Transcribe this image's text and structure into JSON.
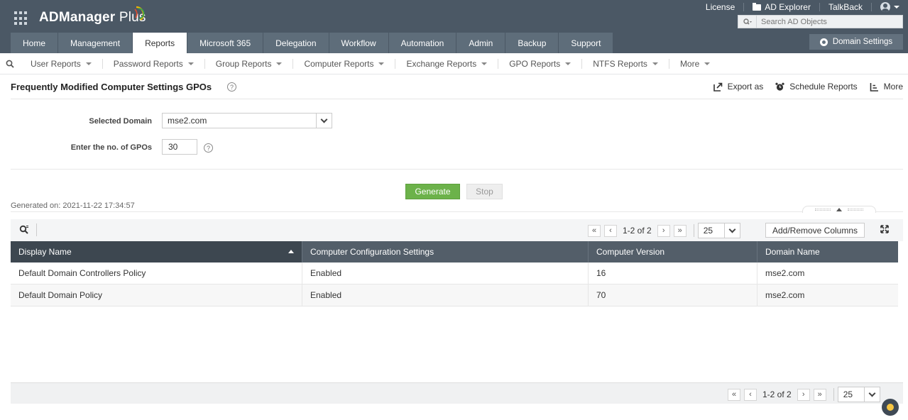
{
  "app": {
    "logo_text": "ADManager",
    "logo_plus": " Plus"
  },
  "top_links": {
    "license": "License",
    "ad_explorer": "AD Explorer",
    "talkback": "TalkBack"
  },
  "search": {
    "placeholder": "Search AD Objects"
  },
  "nav_tabs": [
    "Home",
    "Management",
    "Reports",
    "Microsoft 365",
    "Delegation",
    "Workflow",
    "Automation",
    "Admin",
    "Backup",
    "Support"
  ],
  "domain_settings_label": "Domain Settings",
  "sub_nav": [
    "User Reports",
    "Password Reports",
    "Group Reports",
    "Computer Reports",
    "Exchange Reports",
    "GPO Reports",
    "NTFS Reports",
    "More"
  ],
  "page": {
    "title": "Frequently Modified Computer Settings GPOs",
    "help_glyph": "?",
    "actions": {
      "export": "Export as",
      "schedule": "Schedule Reports",
      "more": "More"
    }
  },
  "form": {
    "domain_label": "Selected Domain",
    "domain_value": "mse2.com",
    "gpo_label": "Enter the no. of GPOs",
    "gpo_value": "30"
  },
  "buttons": {
    "generate": "Generate",
    "stop": "Stop"
  },
  "generated_on": "Generated on: 2021-11-22 17:34:57",
  "pager": {
    "text": "1-2 of 2",
    "page_size": "25",
    "first": "«",
    "prev": "‹",
    "next": "›",
    "last": "»"
  },
  "add_remove_columns": "Add/Remove Columns",
  "table": {
    "headers": [
      "Display Name",
      "Computer Configuration Settings",
      "Computer Version",
      "Domain Name"
    ],
    "rows": [
      [
        "Default Domain Controllers Policy",
        "Enabled",
        "16",
        "mse2.com"
      ],
      [
        "Default Domain Policy",
        "Enabled",
        "70",
        "mse2.com"
      ]
    ]
  },
  "colors": {
    "header_bg": "#4b5865",
    "tab_bg": "#5e6d7a",
    "generate_green": "#6cb24a",
    "table_header": "#535e69"
  }
}
